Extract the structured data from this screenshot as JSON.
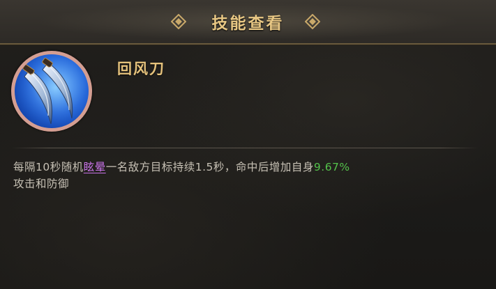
{
  "header": {
    "title": "技能查看"
  },
  "skill": {
    "name": "回风刀",
    "icon": "twin-blades-icon"
  },
  "description": {
    "prefix": "每隔10秒随机",
    "keyword": "眩晕",
    "middle": "一名敌方目标持续1.5秒，命中后增加自身",
    "value": "9.67%",
    "suffix": "攻击和防御"
  },
  "colors": {
    "title_gold": "#e8c784",
    "skill_name_gold": "#e5c27c",
    "keyword_purple": "#c973e8",
    "value_green": "#54c24b",
    "icon_ring": "#d49e92",
    "icon_blue": "#1e5fd6"
  }
}
